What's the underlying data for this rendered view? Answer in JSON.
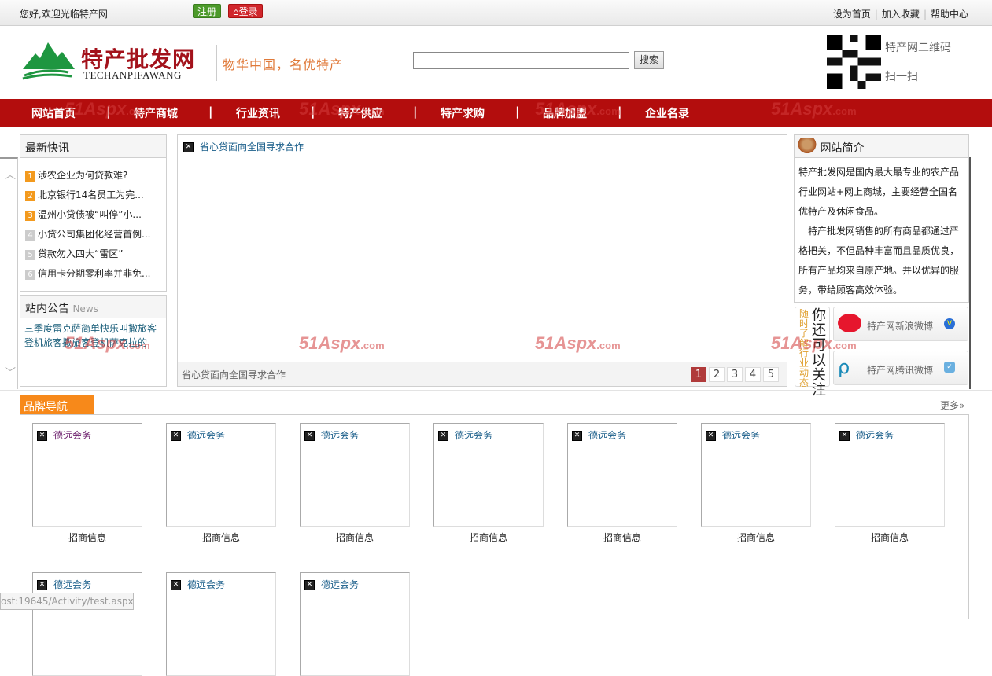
{
  "topbar": {
    "welcome": "您好,欢迎光临特产网",
    "register": "注册",
    "login": "登录",
    "links": [
      "设为首页",
      "加入收藏",
      "帮助中心"
    ]
  },
  "header": {
    "logo_cn": "特产批发网",
    "logo_en": "TECHANPIFAWANG",
    "slogan": "物华中国，名优特产",
    "search_placeholder": "",
    "search_btn": "搜索",
    "qr_label": "特产网二维码",
    "qr_scan": "扫一扫"
  },
  "nav": [
    "网站首页",
    "特产商城",
    "行业资讯",
    "特产供应",
    "特产求购",
    "品牌加盟",
    "企业名录"
  ],
  "watermark": "51Aspx",
  "watermark_suffix": ".com",
  "news": {
    "title": "最新快讯",
    "items": [
      {
        "n": "1",
        "t": "涉农企业为何贷款难?"
      },
      {
        "n": "2",
        "t": "北京银行14名员工为完..."
      },
      {
        "n": "3",
        "t": "温州小贷债被“叫停”小..."
      },
      {
        "n": "4",
        "t": "小贷公司集团化经营首例..."
      },
      {
        "n": "5",
        "t": "贷款勿入四大“雷区”"
      },
      {
        "n": "6",
        "t": "信用卡分期零利率并非免..."
      }
    ]
  },
  "notice": {
    "title": "站内公告",
    "sub": "News",
    "text": "三季度雷克萨简单快乐叫撒旅客登机旅客撒旅客登机萨克拉的"
  },
  "slider": {
    "image_alt": "省心贷面向全国寻求合作",
    "caption": "省心贷面向全国寻求合作",
    "pages": [
      "1",
      "2",
      "3",
      "4",
      "5"
    ],
    "active": "1"
  },
  "about": {
    "title": "网站简介",
    "p1": "特产批发网是国内最大最专业的农产品行业网站+网上商城，主要经营全国名优特产及休闲食品。",
    "p2": "特产批发网销售的所有商品都通过严格把关，不但品种丰富而且品质优良，所有产品均来自原产地。并以优异的服务，带给顾客高效体验。"
  },
  "follow": {
    "tag": "随时了解行业动态",
    "title": "你还可以关注",
    "sina": "特产网新浪微博",
    "tencent": "特产网腾讯微博"
  },
  "brands": {
    "title": "品牌导航",
    "more": "更多»",
    "items": [
      {
        "name": "德远会务",
        "caption": "招商信息"
      },
      {
        "name": "德远会务",
        "caption": "招商信息"
      },
      {
        "name": "德远会务",
        "caption": "招商信息"
      },
      {
        "name": "德远会务",
        "caption": "招商信息"
      },
      {
        "name": "德远会务",
        "caption": "招商信息"
      },
      {
        "name": "德远会务",
        "caption": "招商信息"
      },
      {
        "name": "德远会务",
        "caption": "招商信息"
      },
      {
        "name": "德远会务",
        "caption": ""
      },
      {
        "name": "德远会务",
        "caption": ""
      },
      {
        "name": "德远会务",
        "caption": ""
      }
    ]
  },
  "statusbar": "ost:19645/Activity/test.aspx#"
}
